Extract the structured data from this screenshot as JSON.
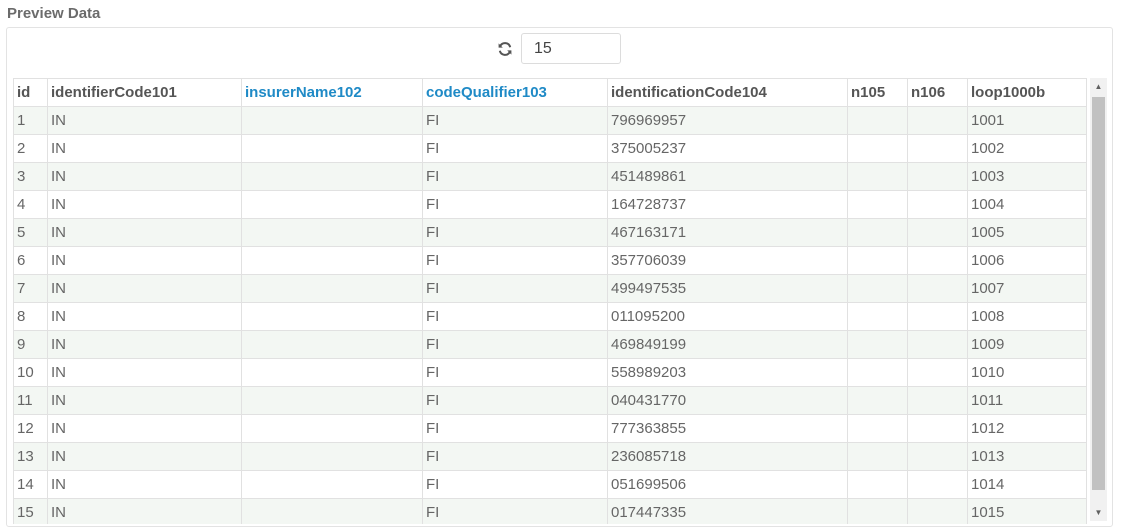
{
  "section": {
    "title": "Preview Data"
  },
  "toolbar": {
    "refresh_icon": "refresh-icon",
    "row_count": "15"
  },
  "table": {
    "columns": [
      {
        "label": "id",
        "accent": false
      },
      {
        "label": "identifierCode101",
        "accent": false
      },
      {
        "label": "insurerName102",
        "accent": true
      },
      {
        "label": "codeQualifier103",
        "accent": true
      },
      {
        "label": "identificationCode104",
        "accent": false
      },
      {
        "label": "n105",
        "accent": false
      },
      {
        "label": "n106",
        "accent": false
      },
      {
        "label": "loop1000b",
        "accent": false
      }
    ],
    "rows": [
      [
        "1",
        "IN",
        "",
        "FI",
        "796969957",
        "",
        "",
        "1001"
      ],
      [
        "2",
        "IN",
        "",
        "FI",
        "375005237",
        "",
        "",
        "1002"
      ],
      [
        "3",
        "IN",
        "",
        "FI",
        "451489861",
        "",
        "",
        "1003"
      ],
      [
        "4",
        "IN",
        "",
        "FI",
        "164728737",
        "",
        "",
        "1004"
      ],
      [
        "5",
        "IN",
        "",
        "FI",
        "467163171",
        "",
        "",
        "1005"
      ],
      [
        "6",
        "IN",
        "",
        "FI",
        "357706039",
        "",
        "",
        "1006"
      ],
      [
        "7",
        "IN",
        "",
        "FI",
        "499497535",
        "",
        "",
        "1007"
      ],
      [
        "8",
        "IN",
        "",
        "FI",
        "011095200",
        "",
        "",
        "1008"
      ],
      [
        "9",
        "IN",
        "",
        "FI",
        "469849199",
        "",
        "",
        "1009"
      ],
      [
        "10",
        "IN",
        "",
        "FI",
        "558989203",
        "",
        "",
        "1010"
      ],
      [
        "11",
        "IN",
        "",
        "FI",
        "040431770",
        "",
        "",
        "1011"
      ],
      [
        "12",
        "IN",
        "",
        "FI",
        "777363855",
        "",
        "",
        "1012"
      ],
      [
        "13",
        "IN",
        "",
        "FI",
        "236085718",
        "",
        "",
        "1013"
      ],
      [
        "14",
        "IN",
        "",
        "FI",
        "051699506",
        "",
        "",
        "1014"
      ],
      [
        "15",
        "IN",
        "",
        "FI",
        "017447335",
        "",
        "",
        "1015"
      ]
    ]
  },
  "colors": {
    "accent_header": "#1f8ac6",
    "row_stripe": "#f3f7f3"
  }
}
